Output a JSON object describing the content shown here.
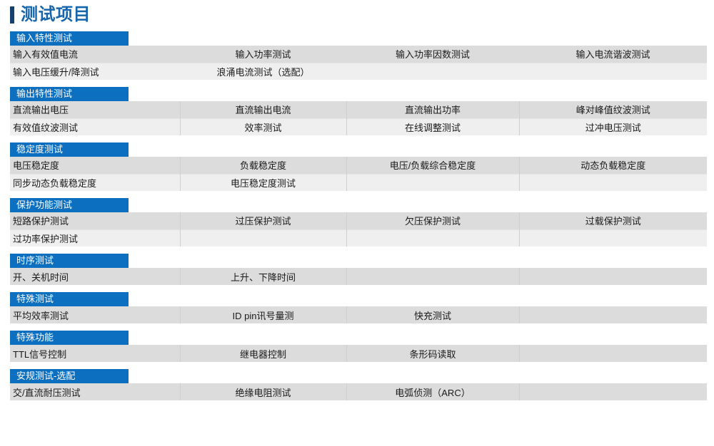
{
  "page": {
    "title": "测试项目",
    "accent_color": "#0c6fc0",
    "title_color": "#1765ab",
    "title_bar_color": "#16406e",
    "row_color_a": "#dcdcdc",
    "row_color_b": "#efefef"
  },
  "sections": [
    {
      "header": "输入特性测试",
      "divided": false,
      "rows": [
        [
          "输入有效值电流",
          "输入功率测试",
          "输入功率因数测试",
          "输入电流谐波测试"
        ],
        [
          "输入电压缓升/降测试",
          "浪涌电流测试（选配）",
          "",
          ""
        ]
      ]
    },
    {
      "header": "输出特性测试",
      "divided": true,
      "rows": [
        [
          "直流输出电压",
          "直流输出电流",
          "直流输出功率",
          "峰对峰值纹波测试"
        ],
        [
          "有效值纹波测试",
          "效率测试",
          "在线调整测试",
          "过冲电压测试"
        ]
      ]
    },
    {
      "header": "稳定度测试",
      "divided": true,
      "rows": [
        [
          "电压稳定度",
          "负载稳定度",
          "电压/负载综合稳定度",
          "动态负载稳定度"
        ],
        [
          "同步动态负载稳定度",
          "电压稳定度测试",
          "",
          ""
        ]
      ]
    },
    {
      "header": "保护功能测试",
      "divided": true,
      "rows": [
        [
          "短路保护测试",
          "过压保护测试",
          "欠压保护测试",
          "过载保护测试"
        ],
        [
          "过功率保护测试",
          "",
          "",
          ""
        ]
      ]
    },
    {
      "header": "时序测试",
      "divided": true,
      "rows": [
        [
          "开、关机时间",
          "上升、下降时间",
          "",
          ""
        ]
      ]
    },
    {
      "header": "特殊测试",
      "divided": true,
      "rows": [
        [
          "平均效率测试",
          "ID pin讯号量测",
          "快充测试",
          ""
        ]
      ]
    },
    {
      "header": "特殊功能",
      "divided": true,
      "rows": [
        [
          "TTL信号控制",
          "继电器控制",
          "条形码读取",
          ""
        ]
      ]
    },
    {
      "header": "安规测试-选配",
      "divided": true,
      "rows": [
        [
          "交/直流耐压测试",
          "绝缘电阻测试",
          "电弧侦测（ARC）",
          ""
        ]
      ]
    }
  ]
}
